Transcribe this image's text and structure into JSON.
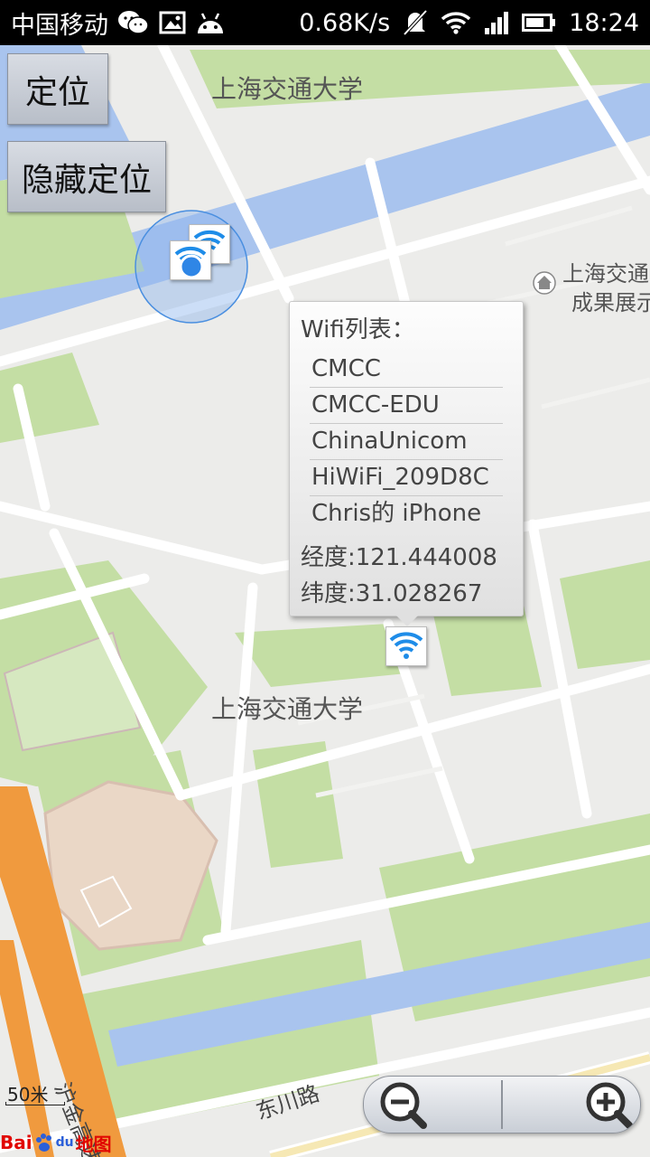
{
  "status_bar": {
    "carrier": "中国移动",
    "net_speed": "0.68K/s",
    "time": "18:24"
  },
  "buttons": {
    "locate": "定位",
    "hide_locate": "隐藏定位"
  },
  "map_labels": {
    "campus_top": "上海交通大学",
    "campus_mid": "上海交通大学",
    "poi_line1": "上海交通",
    "poi_line2": "成果展示",
    "road_dongchuan": "东川路",
    "road_hujin": "沪金高速"
  },
  "popup": {
    "title": "Wifi列表：",
    "wifi_list": [
      "CMCC",
      "CMCC-EDU",
      "ChinaUnicom",
      "HiWiFi_209D8C",
      "Chris的 iPhone"
    ],
    "longitude": "经度:121.444008",
    "latitude": "纬度:31.028267"
  },
  "scale": "50米",
  "baidu_logo": {
    "text1": "Bai",
    "text2": "du",
    "text3": "地图"
  },
  "colors": {
    "water": "#a9c4ee",
    "green": "#c4dea4",
    "road": "#ffffff",
    "highway": "#f09a3e",
    "location_dot": "#2f86e6",
    "wifi_blue": "#1e8ce8"
  },
  "icons": {
    "wechat": "wechat-icon",
    "gallery": "gallery-icon",
    "android": "android-icon",
    "mute": "mute-icon",
    "wifi": "wifi-icon",
    "signal": "signal-icon",
    "battery": "battery-icon",
    "zoom_out": "zoom-out-icon",
    "zoom_in": "zoom-in-icon"
  }
}
